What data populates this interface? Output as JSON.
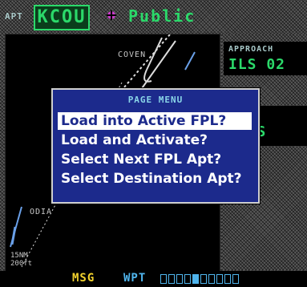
{
  "top_bar": {
    "apt_label": "APT",
    "apt_identifier": "KCOU",
    "apt_type_icon": "airport-symbol-icon",
    "apt_type": "Public"
  },
  "map": {
    "waypoints": [
      {
        "label": "COVEN"
      },
      {
        "label": "ODIA"
      }
    ],
    "scale_range": "15",
    "scale_unit": "NM",
    "scale_label": "200ft"
  },
  "right_panel": {
    "approach_title": "APPROACH",
    "approach_value": "ILS 02",
    "transition_title": "S",
    "transition_value": "TORS"
  },
  "page_menu": {
    "title": "PAGE MENU",
    "items": [
      {
        "label": "Load into Active FPL?",
        "selected": true
      },
      {
        "label": "Load and Activate?",
        "selected": false
      },
      {
        "label": "Select Next FPL Apt?",
        "selected": false
      },
      {
        "label": "Select Destination Apt?",
        "selected": false
      }
    ]
  },
  "status_bar": {
    "msg": "MSG",
    "page_group": "WPT",
    "page_count": 10,
    "active_page": 4
  },
  "colors": {
    "identifier_green": "#2bd96a",
    "menu_blue": "#1c2a8c",
    "msg_yellow": "#f2d22e",
    "page_cyan": "#4fb4ec"
  }
}
